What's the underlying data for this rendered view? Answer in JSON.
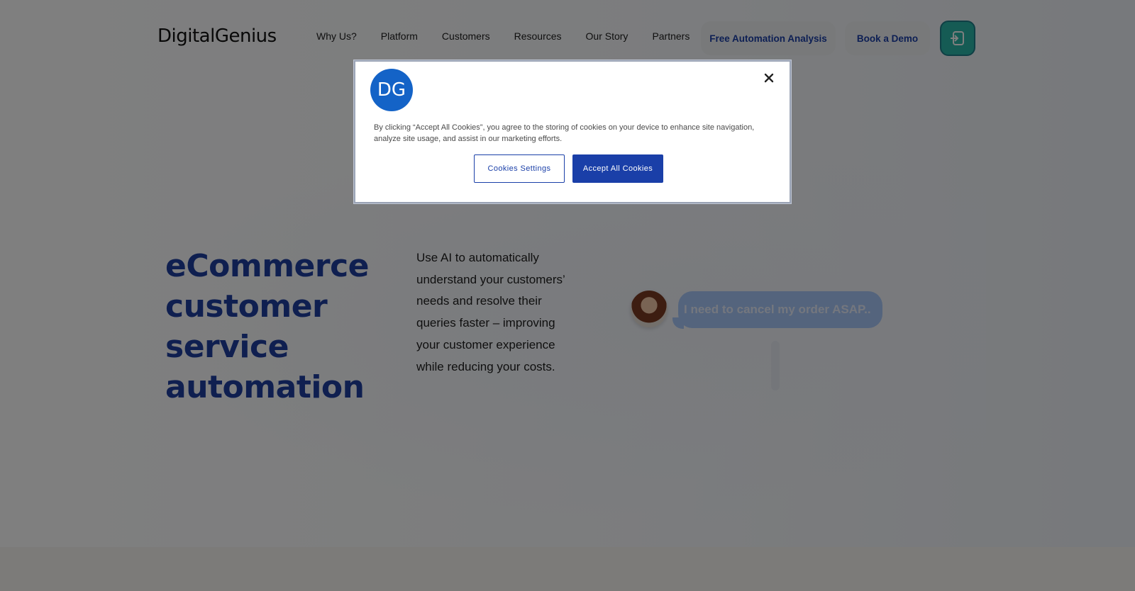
{
  "header": {
    "logo_light": "Digital",
    "logo_strong": "Genius",
    "nav": [
      "Why Us?",
      "Platform",
      "Customers",
      "Resources",
      "Our Story",
      "Partners"
    ],
    "cta_analysis": "Free Automation Analysis",
    "cta_demo": "Book a Demo",
    "login_icon": "login-arrow-icon"
  },
  "hero": {
    "headline": "eCommerce customer service automation",
    "subcopy": "Use AI to automatically understand your customers’ needs and resolve their queries faster – improving your customer experience while reducing your costs.",
    "chat_message": "I need to cancel my order ASAP.."
  },
  "cookie_banner": {
    "logo_text": "DG",
    "close_icon": "close-icon",
    "text": "By clicking “Accept All Cookies”, you agree to the storing of cookies on your device to enhance site navigation, analyze site usage, and assist in our marketing efforts.",
    "settings_label": "Cookies Settings",
    "accept_label": "Accept All Cookies"
  },
  "colors": {
    "brand_blue": "#1a3fa8",
    "logo_circle": "#1463c7",
    "teal": "#2bb7a9"
  }
}
